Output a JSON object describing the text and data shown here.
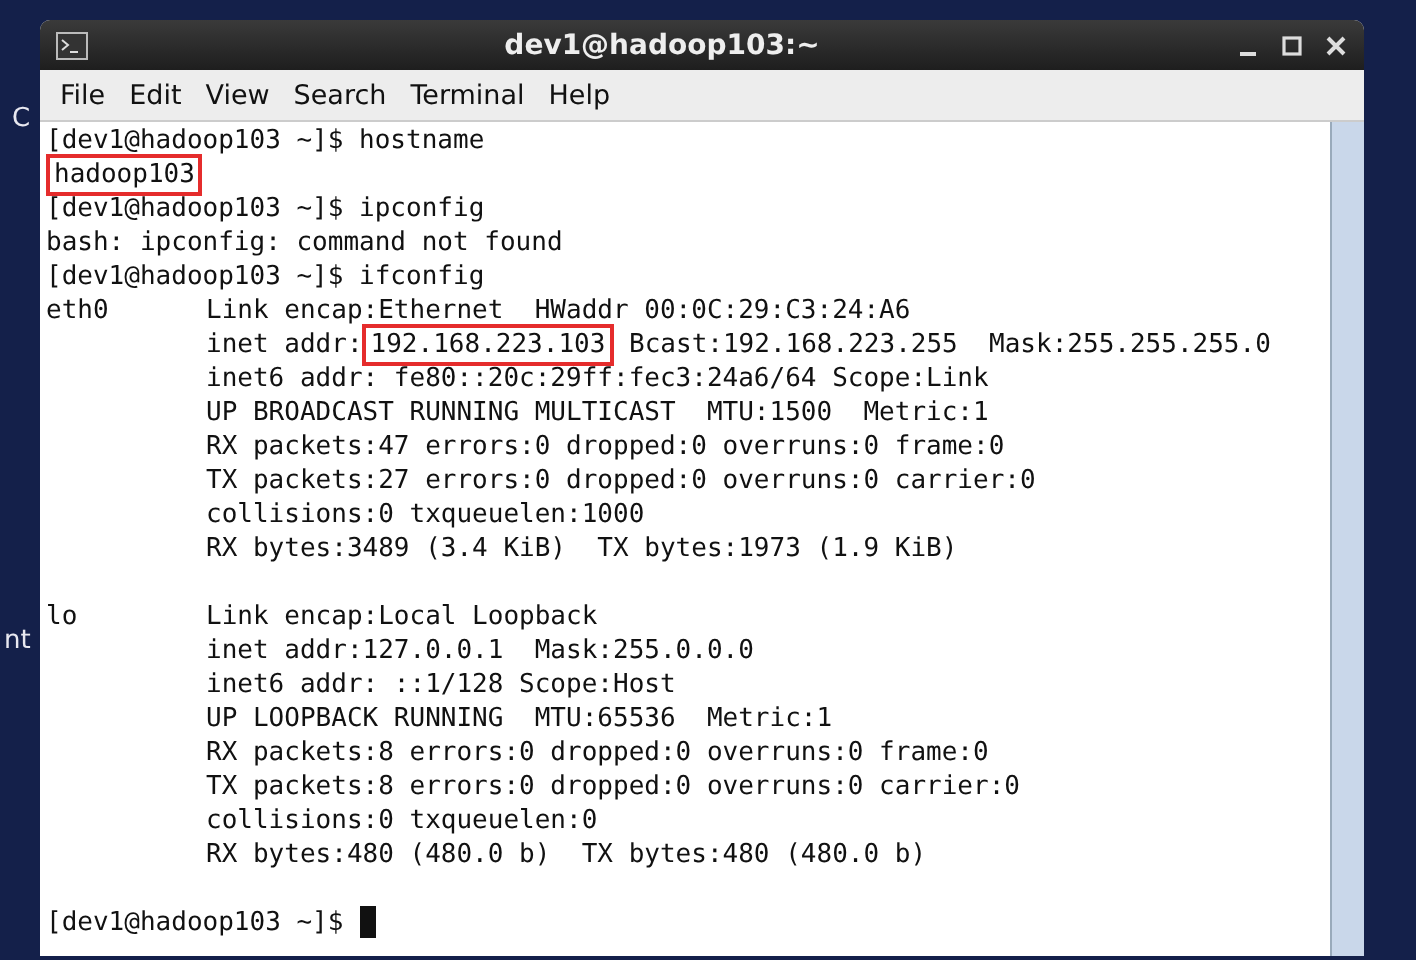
{
  "desktop": {
    "labels": [
      "C",
      "nt"
    ]
  },
  "window": {
    "title": "dev1@hadoop103:~"
  },
  "menu": [
    "File",
    "Edit",
    "View",
    "Search",
    "Terminal",
    "Help"
  ],
  "terminal": {
    "lines": [
      {
        "kind": "text",
        "segments": [
          {
            "text": "[dev1@hadoop103 ~]$ hostname",
            "boxed": false
          }
        ]
      },
      {
        "kind": "text",
        "segments": [
          {
            "text": "hadoop103",
            "boxed": true
          }
        ]
      },
      {
        "kind": "text",
        "segments": [
          {
            "text": "[dev1@hadoop103 ~]$ ipconfig",
            "boxed": false
          }
        ]
      },
      {
        "kind": "text",
        "segments": [
          {
            "text": "bash: ipconfig: command not found",
            "boxed": false
          }
        ]
      },
      {
        "kind": "text",
        "segments": [
          {
            "text": "[dev1@hadoop103 ~]$ ifconfig",
            "boxed": false
          }
        ]
      },
      {
        "kind": "text",
        "label": "eth0",
        "segments": [
          {
            "text": "Link encap:Ethernet  HWaddr 00:0C:29:C3:24:A6",
            "boxed": false
          }
        ]
      },
      {
        "kind": "text",
        "segments": [
          {
            "text": "inet addr:",
            "boxed": false
          },
          {
            "text": "192.168.223.103",
            "boxed": true
          },
          {
            "text": " Bcast:192.168.223.255  Mask:255.255.255.0",
            "boxed": false
          }
        ]
      },
      {
        "kind": "text",
        "segments": [
          {
            "text": "inet6 addr: fe80::20c:29ff:fec3:24a6/64 Scope:Link",
            "boxed": false
          }
        ]
      },
      {
        "kind": "text",
        "segments": [
          {
            "text": "UP BROADCAST RUNNING MULTICAST  MTU:1500  Metric:1",
            "boxed": false
          }
        ]
      },
      {
        "kind": "text",
        "segments": [
          {
            "text": "RX packets:47 errors:0 dropped:0 overruns:0 frame:0",
            "boxed": false
          }
        ]
      },
      {
        "kind": "text",
        "segments": [
          {
            "text": "TX packets:27 errors:0 dropped:0 overruns:0 carrier:0",
            "boxed": false
          }
        ]
      },
      {
        "kind": "text",
        "segments": [
          {
            "text": "collisions:0 txqueuelen:1000",
            "boxed": false
          }
        ]
      },
      {
        "kind": "text",
        "segments": [
          {
            "text": "RX bytes:3489 (3.4 KiB)  TX bytes:1973 (1.9 KiB)",
            "boxed": false
          }
        ]
      },
      {
        "kind": "blank"
      },
      {
        "kind": "text",
        "label": "lo",
        "segments": [
          {
            "text": "Link encap:Local Loopback",
            "boxed": false
          }
        ]
      },
      {
        "kind": "text",
        "segments": [
          {
            "text": "inet addr:127.0.0.1  Mask:255.0.0.0",
            "boxed": false
          }
        ]
      },
      {
        "kind": "text",
        "segments": [
          {
            "text": "inet6 addr: ::1/128 Scope:Host",
            "boxed": false
          }
        ]
      },
      {
        "kind": "text",
        "segments": [
          {
            "text": "UP LOOPBACK RUNNING  MTU:65536  Metric:1",
            "boxed": false
          }
        ]
      },
      {
        "kind": "text",
        "segments": [
          {
            "text": "RX packets:8 errors:0 dropped:0 overruns:0 frame:0",
            "boxed": false
          }
        ]
      },
      {
        "kind": "text",
        "segments": [
          {
            "text": "TX packets:8 errors:0 dropped:0 overruns:0 carrier:0",
            "boxed": false
          }
        ]
      },
      {
        "kind": "text",
        "segments": [
          {
            "text": "collisions:0 txqueuelen:0",
            "boxed": false
          }
        ]
      },
      {
        "kind": "text",
        "segments": [
          {
            "text": "RX bytes:480 (480.0 b)  TX bytes:480 (480.0 b)",
            "boxed": false
          }
        ]
      },
      {
        "kind": "blank"
      },
      {
        "kind": "prompt",
        "cursor": true,
        "segments": [
          {
            "text": "[dev1@hadoop103 ~]$",
            "boxed": false
          }
        ]
      }
    ]
  }
}
